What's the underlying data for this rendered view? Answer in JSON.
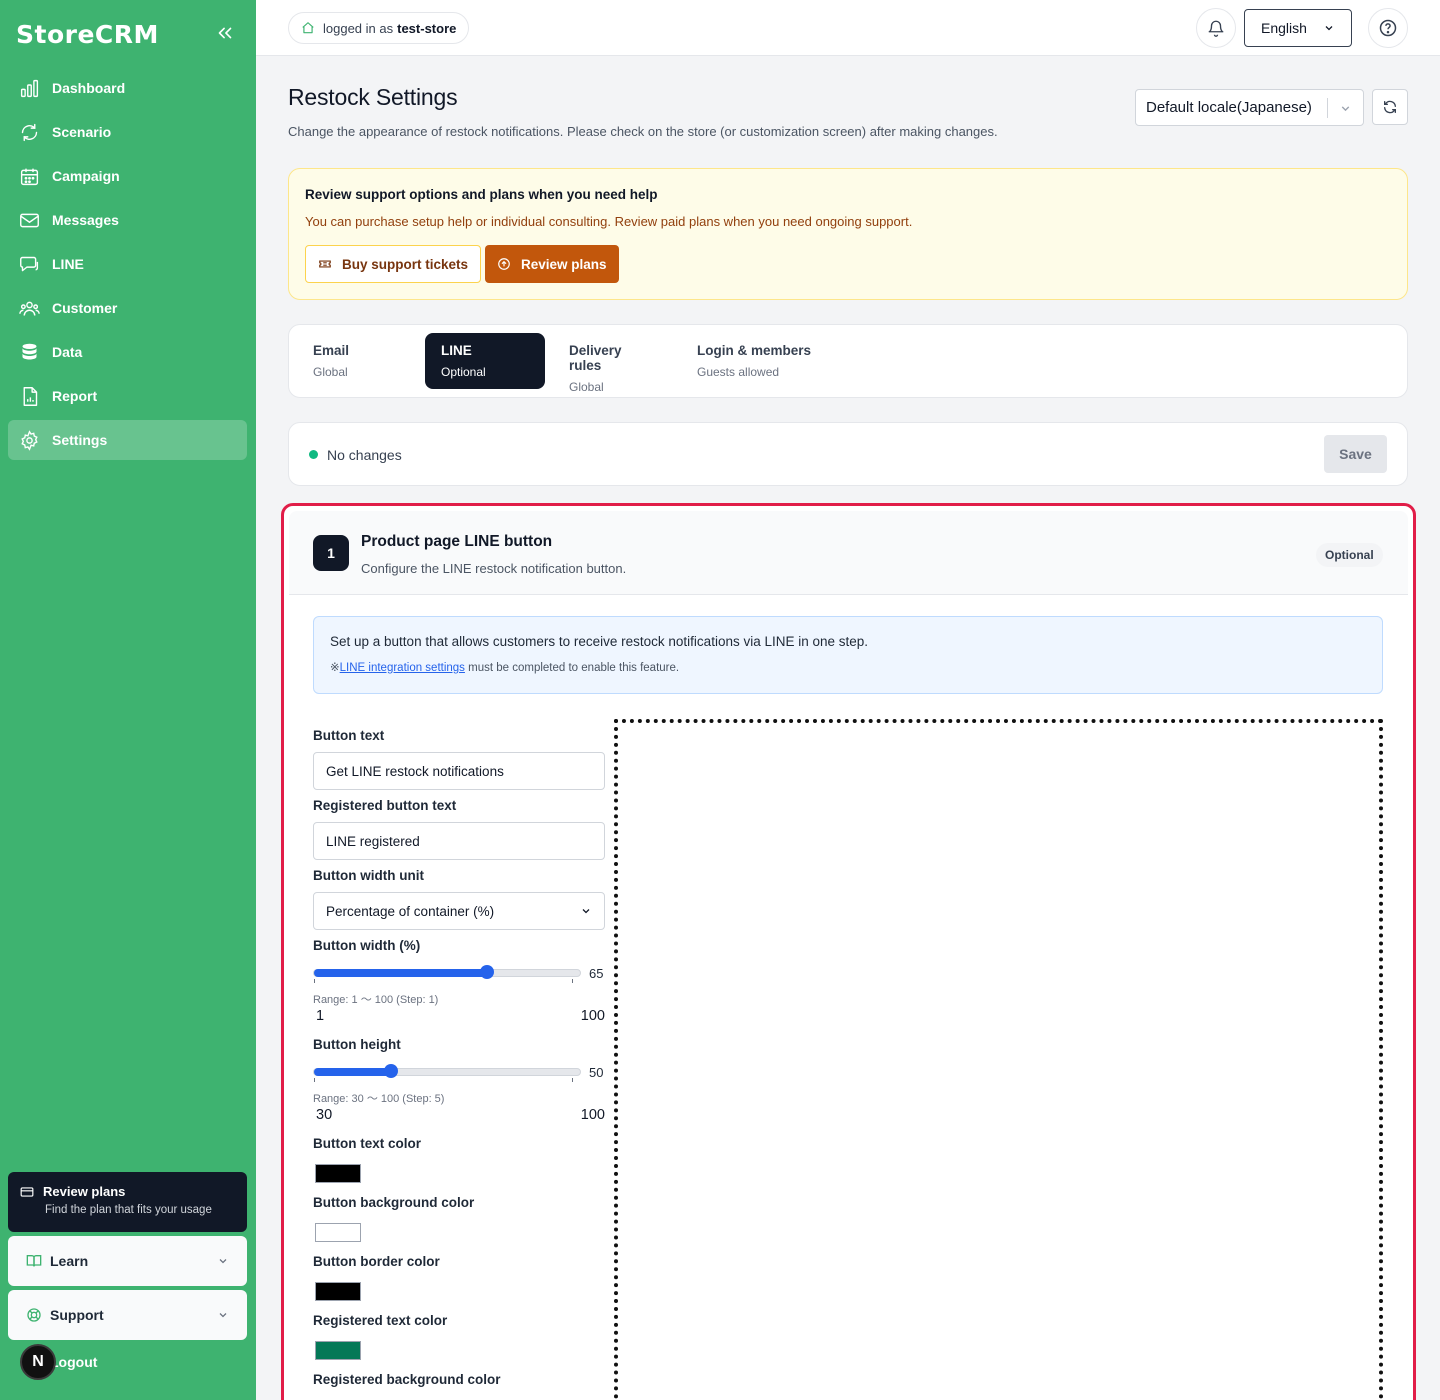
{
  "sidebar": {
    "brand": "StoreCRM",
    "items": [
      {
        "label": "Dashboard",
        "icon": "bar-chart-icon"
      },
      {
        "label": "Scenario",
        "icon": "workflow-icon"
      },
      {
        "label": "Campaign",
        "icon": "calendar-icon"
      },
      {
        "label": "Messages",
        "icon": "mail-icon"
      },
      {
        "label": "LINE",
        "icon": "chat-icon"
      },
      {
        "label": "Customer",
        "icon": "users-icon"
      },
      {
        "label": "Data",
        "icon": "database-icon"
      },
      {
        "label": "Report",
        "icon": "report-icon"
      },
      {
        "label": "Settings",
        "icon": "gear-icon",
        "active": true
      }
    ],
    "plan_card": {
      "title": "Review plans",
      "subtitle": "Find the plan that fits your usage"
    },
    "learn": "Learn",
    "support": "Support",
    "logout": "Logout",
    "avatar": "N"
  },
  "topbar": {
    "logged_in_prefix": "logged in as",
    "store": "test-store",
    "language": "English"
  },
  "page": {
    "title": "Restock Settings",
    "description": "Change the appearance of restock notifications. Please check on the store (or customization screen) after making changes.",
    "locale": "Default locale(Japanese)"
  },
  "notice": {
    "title": "Review support options and plans when you need help",
    "description": "You can purchase setup help or individual consulting. Review paid plans when you need ongoing support.",
    "buy_label": "Buy support tickets",
    "plans_label": "Review plans"
  },
  "tabs": [
    {
      "label": "Email",
      "sub": "Global"
    },
    {
      "label": "LINE",
      "sub": "Optional",
      "active": true
    },
    {
      "label": "Delivery rules",
      "sub": "Global"
    },
    {
      "label": "Login & members",
      "sub": "Guests allowed"
    }
  ],
  "status": {
    "text": "No changes",
    "save_label": "Save"
  },
  "panel": {
    "step": "1",
    "title": "Product page LINE button",
    "subtitle": "Configure the LINE restock notification button.",
    "badge": "Optional",
    "info_text": "Set up a button that allows customers to receive restock notifications via LINE in one step.",
    "info_note_prefix": "※",
    "info_link": "LINE integration settings",
    "info_note_suffix": " must be completed to enable this feature."
  },
  "form": {
    "button_text_label": "Button text",
    "button_text_value": "Get LINE restock notifications",
    "registered_text_label": "Registered button text",
    "registered_text_value": "LINE registered",
    "width_unit_label": "Button width unit",
    "width_unit_value": "Percentage of container (%)",
    "width_label": "Button width (%)",
    "width_value": 65,
    "width_range": "Range: 1 〜 100  (Step: 1)",
    "width_min": "1",
    "width_max": "100",
    "height_label": "Button height",
    "height_value": 50,
    "height_range": "Range: 30 〜 100  (Step: 5)",
    "height_min": "30",
    "height_max": "100",
    "text_color_label": "Button text color",
    "text_color": "#000000",
    "bg_color_label": "Button background color",
    "bg_color": "#ffffff",
    "border_color_label": "Button border color",
    "border_color": "#000000",
    "reg_text_color_label": "Registered text color",
    "reg_text_color": "#047857",
    "reg_bg_color_label": "Registered background color"
  },
  "colors": {
    "sidebar": "#3eb370",
    "accent": "#2563eb",
    "danger_border": "#e11d48",
    "cta": "#c2570c"
  }
}
